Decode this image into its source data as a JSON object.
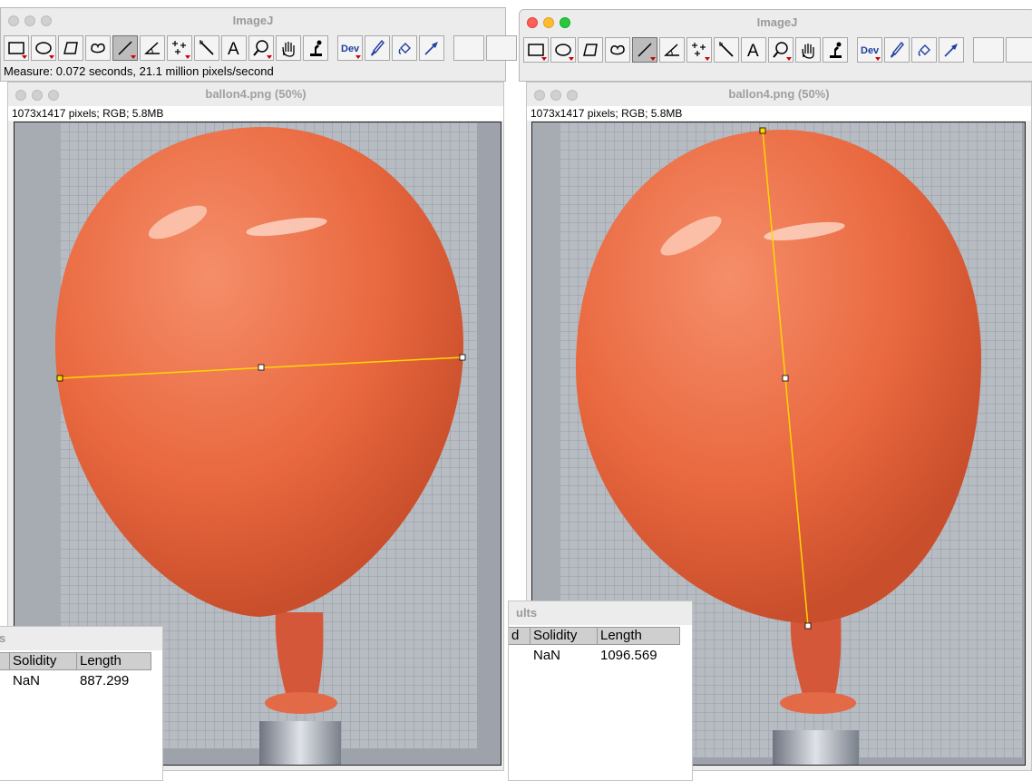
{
  "app": {
    "title": "ImageJ"
  },
  "toolbar_tools": [
    {
      "name": "rectangle-tool-icon"
    },
    {
      "name": "oval-tool-icon"
    },
    {
      "name": "polygon-tool-icon"
    },
    {
      "name": "freehand-tool-icon"
    },
    {
      "name": "straight-line-tool-icon",
      "selected": true
    },
    {
      "name": "angle-tool-icon"
    },
    {
      "name": "multipoint-tool-icon"
    },
    {
      "name": "wand-tool-icon"
    },
    {
      "name": "text-tool-icon"
    },
    {
      "name": "magnifier-tool-icon"
    },
    {
      "name": "hand-tool-icon"
    },
    {
      "name": "dropper-tool-icon"
    },
    {
      "name": "dev-menu-icon",
      "label": "Dev"
    },
    {
      "name": "brush-tool-icon"
    },
    {
      "name": "flood-fill-tool-icon"
    },
    {
      "name": "arrow-tool-icon"
    }
  ],
  "left": {
    "status": "Measure: 0.072 seconds, 21.1 million pixels/second",
    "image_title": "ballon4.png (50%)",
    "image_info": "1073x1417 pixels; RGB; 5.8MB",
    "results_title": "s",
    "results_headers": [
      "Solidity",
      "Length"
    ],
    "results_row": [
      "NaN",
      "887.299"
    ]
  },
  "right": {
    "image_title": "ballon4.png (50%)",
    "image_info": "1073x1417 pixels; RGB; 5.8MB",
    "results_title": "ults",
    "results_headers": [
      "d",
      "Solidity",
      "Length"
    ],
    "results_row": [
      "NaN",
      "1096.569"
    ]
  },
  "colors": {
    "balloon": "#e9683f",
    "selection": "#ffd700",
    "paper": "#9ea3ab"
  }
}
